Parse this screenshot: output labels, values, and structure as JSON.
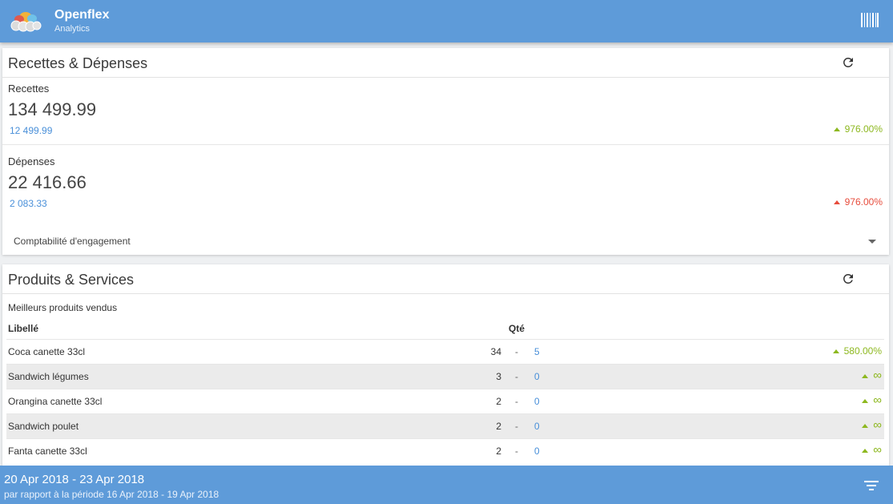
{
  "app": {
    "title": "Openflex",
    "subtitle": "Analytics"
  },
  "colors": {
    "primary": "#5e9bd9",
    "positive": "#8db81f",
    "negative": "#e74c3c",
    "link": "#4a90d9"
  },
  "recettes_depenses": {
    "title": "Recettes & Dépenses",
    "recettes": {
      "label": "Recettes",
      "value": "134 499.99",
      "previous": "12 499.99",
      "change": "976.00%"
    },
    "depenses": {
      "label": "Dépenses",
      "value": "22 416.66",
      "previous": "2 083.33",
      "change": "976.00%"
    },
    "dropdown": {
      "selected": "Comptabilité d'engagement"
    }
  },
  "produits_services": {
    "title": "Produits & Services",
    "section_label": "Meilleurs produits vendus",
    "columns": {
      "label": "Libellé",
      "qty": "Qté"
    },
    "rows": [
      {
        "name": "Coca canette 33cl",
        "qty": "34",
        "sep": "-",
        "previous": "5",
        "change": "580.00%"
      },
      {
        "name": "Sandwich légumes",
        "qty": "3",
        "sep": "-",
        "previous": "0",
        "change": "∞"
      },
      {
        "name": "Orangina canette 33cl",
        "qty": "2",
        "sep": "-",
        "previous": "0",
        "change": "∞"
      },
      {
        "name": "Sandwich poulet",
        "qty": "2",
        "sep": "-",
        "previous": "0",
        "change": "∞"
      },
      {
        "name": "Fanta canette 33cl",
        "qty": "2",
        "sep": "-",
        "previous": "0",
        "change": "∞"
      }
    ]
  },
  "footer": {
    "range": "20 Apr 2018 - 23 Apr 2018",
    "compare": "par rapport à la période 16 Apr 2018 - 19 Apr 2018"
  },
  "icons": {
    "logo": "cloud-logo-icon",
    "barcode": "barcode-icon",
    "refresh": "refresh-icon",
    "filter": "filter-icon",
    "trend_up": "triangle-up-icon",
    "dropdown": "caret-down-icon"
  }
}
